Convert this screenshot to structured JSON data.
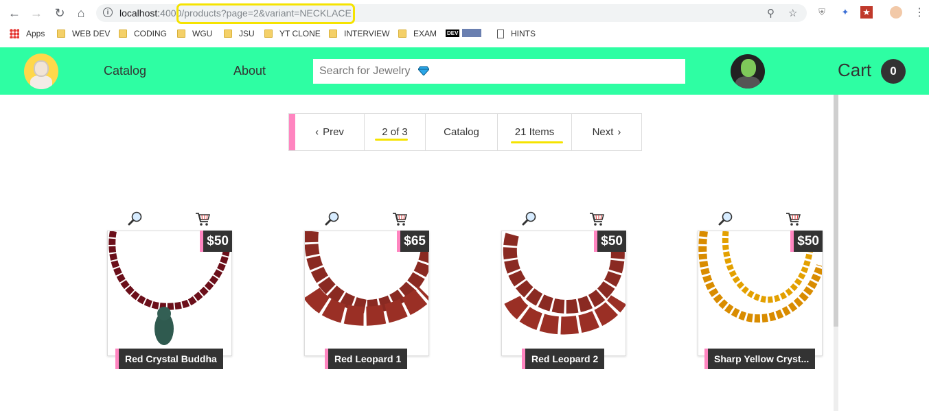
{
  "browser": {
    "url_host": "localhost:",
    "url_port": "4000",
    "url_path": "/products?page=2&variant=NECKLACE",
    "bookmarks": [
      "Apps",
      "WEB DEV",
      "CODING",
      "WGU",
      "JSU",
      "YT CLONE",
      "INTERVIEW",
      "EXAM",
      "HINTS"
    ],
    "dev_badge": "DEV"
  },
  "header": {
    "nav": [
      "Catalog",
      "About"
    ],
    "search_placeholder": "Search for Jewelry",
    "cart_label": "Cart",
    "cart_count": "0",
    "brand_color": "#2efea3",
    "accent_color": "#ff85c0"
  },
  "pager": {
    "prev": "Prev",
    "page": "2 of 3",
    "catalog": "Catalog",
    "items": "21 Items",
    "next": "Next"
  },
  "products": [
    {
      "name": "Red Crystal Buddha",
      "price": "$50"
    },
    {
      "name": "Red Leopard 1",
      "price": "$65"
    },
    {
      "name": "Red Leopard 2",
      "price": "$50"
    },
    {
      "name": "Sharp Yellow Cryst...",
      "price": "$50"
    }
  ]
}
